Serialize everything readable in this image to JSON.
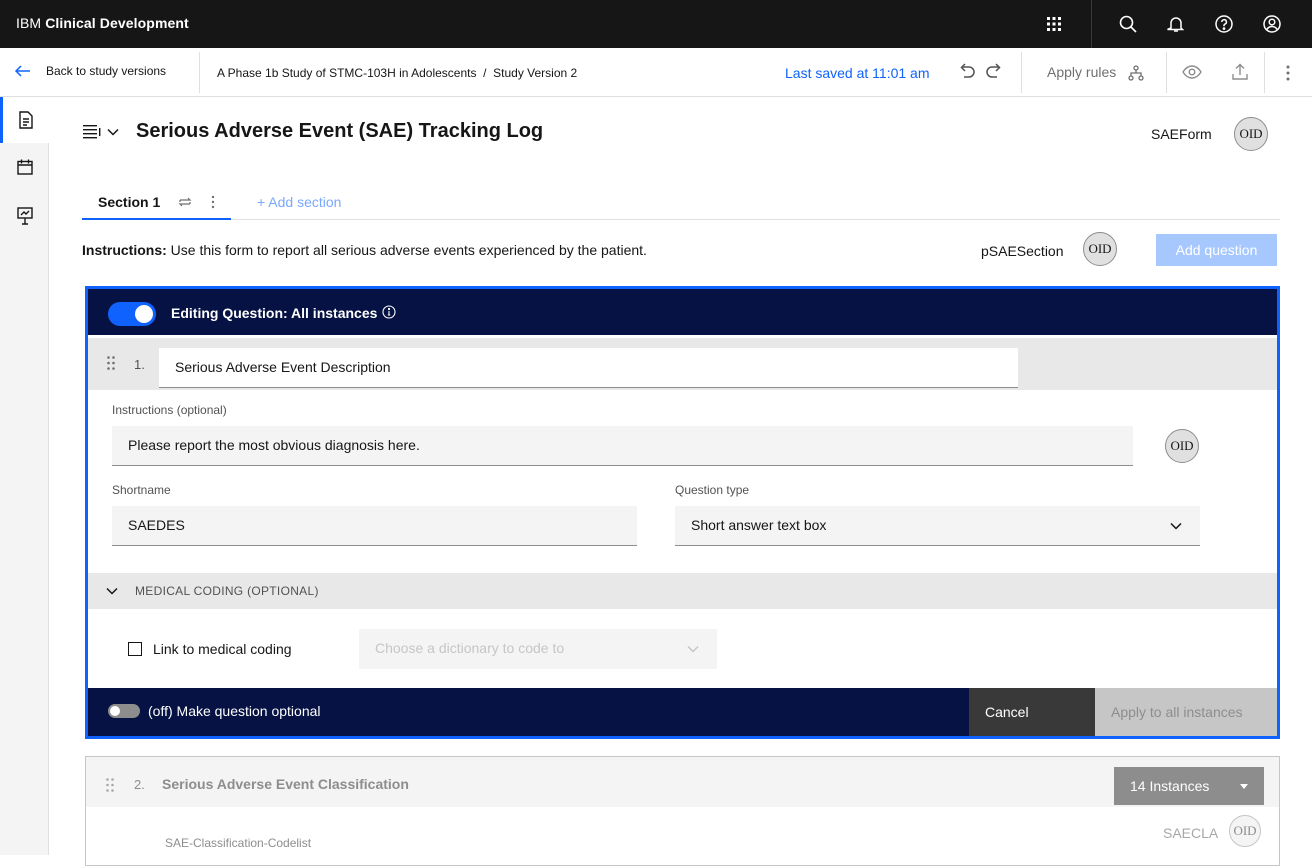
{
  "header": {
    "brand_prefix": "IBM",
    "brand_name": "Clinical Development",
    "icons": [
      "app-switcher-icon",
      "search-icon",
      "notification-icon",
      "help-icon",
      "user-icon"
    ]
  },
  "subbar": {
    "back_label": "Back to study versions",
    "breadcrumb": "A Phase 1b Study of STMC-103H in Adolescents  /  Study Version 2",
    "last_saved": "Last saved at 11:01 am",
    "apply_rules": "Apply rules"
  },
  "form": {
    "title": "Serious Adverse Event (SAE) Tracking Log",
    "oid_name": "SAEForm",
    "oid_badge": "OID"
  },
  "tabs": {
    "section_label": "Section 1",
    "add_section": "+ Add section"
  },
  "section": {
    "instructions_label": "Instructions:",
    "instructions_text": " Use this form to report all serious adverse events experienced by the patient.",
    "oid_name": "pSAESection",
    "oid_badge": "OID",
    "add_question": "Add question"
  },
  "editor": {
    "header": "Editing Question: All instances",
    "toggle_on": true,
    "question_number": "1.",
    "question_text": "Serious Adverse Event Description",
    "instructions_label": "Instructions (optional)",
    "instructions_value": "Please report the most obvious diagnosis here.",
    "oid_badge": "OID",
    "shortname_label": "Shortname",
    "shortname_value": "SAEDES",
    "type_label": "Question type",
    "type_value": "Short answer text box",
    "coding_header": "MEDICAL CODING (OPTIONAL)",
    "coding_checkbox_label": "Link to medical coding",
    "coding_dict_placeholder": "Choose a dictionary to code to",
    "optional_toggle_label": "(off) Make question optional",
    "cancel": "Cancel",
    "apply_all": "Apply to all instances"
  },
  "question2": {
    "number": "2.",
    "title": "Serious Adverse Event Classification",
    "instances": "14 Instances",
    "codelist": "SAE-Classification-Codelist",
    "shortname": "SAECLA",
    "oid_badge": "OID"
  },
  "colors": {
    "topbar": "#161616",
    "accent": "#0f62fe",
    "editor_dark": "#051243"
  }
}
